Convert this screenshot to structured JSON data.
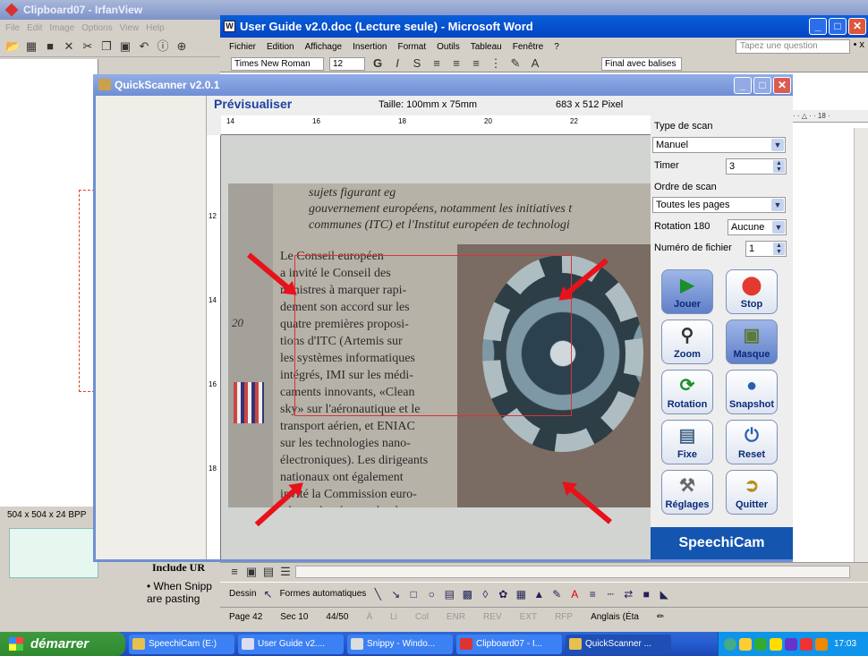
{
  "irfanview": {
    "title": "Clipboard07 - IrfanView",
    "menu": [
      "File",
      "Edit",
      "Image",
      "Options",
      "View",
      "Help"
    ],
    "status": "504 x 504 x 24 BPP"
  },
  "word": {
    "title": "User Guide v2.0.doc (Lecture seule) - Microsoft Word",
    "menu": [
      "Fichier",
      "Edition",
      "Affichage",
      "Insertion",
      "Format",
      "Outils",
      "Tableau",
      "Fenêtre",
      "?"
    ],
    "question_placeholder": "Tapez une question",
    "font": "Times New Roman",
    "font_size": "12",
    "track_changes": "Final avec balises",
    "ruler_text": "· · △ · · 18 ·",
    "heading": "Include UR",
    "bullet": "When Snipp are pasting",
    "draw_label": "Dessin",
    "autoshapes_label": "Formes automatiques",
    "status": {
      "page": "Page 42",
      "section": "Sec 10",
      "pages": "44/50",
      "at": "À",
      "line": "Li",
      "col": "Col",
      "enr": "ENR",
      "rev": "REV",
      "ext": "EXT",
      "rfp": "RFP",
      "lang": "Anglais (Éta"
    }
  },
  "quickscanner": {
    "title": "QuickScanner v2.0.1",
    "preview_title": "Prévisualiser",
    "size_label": "Taille: 100mm x 75mm",
    "pixels_label": "683 x 512 Pixel",
    "ruler_h": [
      "14",
      "16",
      "18",
      "20",
      "22"
    ],
    "ruler_v": [
      "12",
      "14",
      "16",
      "18"
    ],
    "photo_text_top": "sujets figurant eg\ngouvernement européens, notamment les initiatives t\ncommunes (ITC) et l'Institut européen de technologi",
    "photo_text_col": "Le Conseil européen\na invité le Conseil des\nministres à marquer rapi-\ndement son accord sur les\nquatre premières proposi-\ntions d'ITC (Artemis sur\nles systèmes informatiques\nintégrés, IMI sur les médi-\ncaments innovants, «Clean\nsky» sur l'aéronautique et le\ntransport aérien, et ENIAC\nsur les technologies nano-\nélectroniques). Les dirigeants\nnationaux ont également\ninvité la Commission euro-\npéenne à présenter le plus",
    "margin_number": "20",
    "type_label": "Type de scan",
    "type_value": "Manuel",
    "timer_label": "Timer",
    "timer_value": "3",
    "order_label": "Ordre de scan",
    "order_value": "Toutes les pages",
    "rotation_label": "Rotation 180",
    "rotation_value": "Aucune",
    "file_label": "Numéro de fichier",
    "file_value": "1",
    "buttons": {
      "play": "Jouer",
      "stop": "Stop",
      "zoom": "Zoom",
      "mask": "Masque",
      "rotation": "Rotation",
      "snapshot": "Snapshot",
      "fix": "Fixe",
      "reset": "Reset",
      "settings": "Réglages",
      "quit": "Quitter"
    },
    "brand": "SpeechiCam"
  },
  "taskbar": {
    "start": "démarrer",
    "tasks": [
      "SpeechiCam (E:)",
      "User Guide v2....",
      "Snippy - Windo...",
      "Clipboard07 - I...",
      "QuickScanner ..."
    ],
    "clock": "17:03"
  }
}
